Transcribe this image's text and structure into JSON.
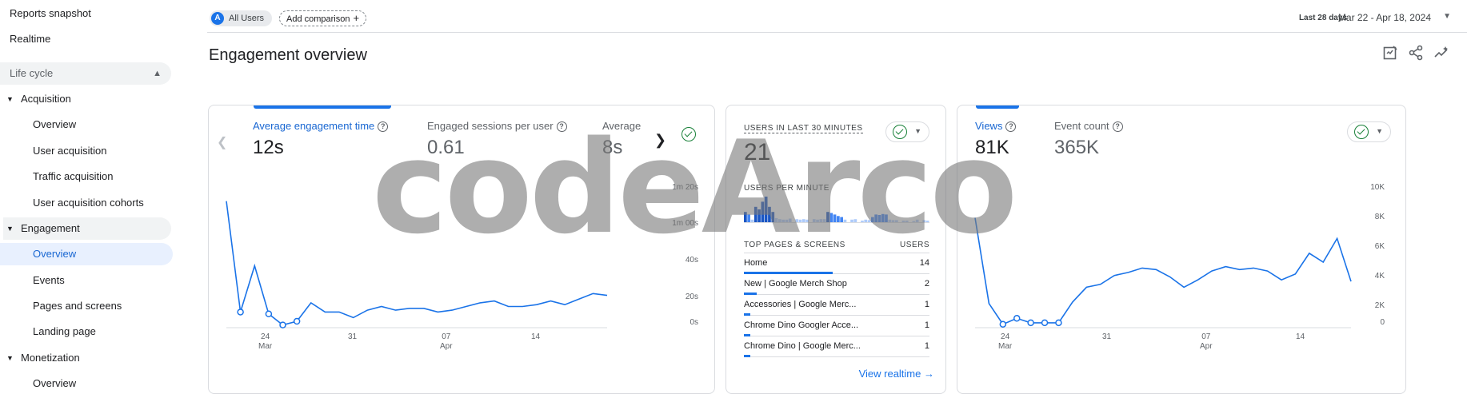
{
  "sidebar": {
    "reports_snapshot": "Reports snapshot",
    "realtime": "Realtime",
    "lifecycle": "Life cycle",
    "acquisition": "Acquisition",
    "acq_items": [
      "Overview",
      "User acquisition",
      "Traffic acquisition",
      "User acquisition cohorts"
    ],
    "engagement": "Engagement",
    "eng_items": [
      "Overview",
      "Events",
      "Pages and screens",
      "Landing page"
    ],
    "monetization": "Monetization",
    "mon_items": [
      "Overview"
    ]
  },
  "topbar": {
    "segment_initial": "A",
    "segment_label": "All Users",
    "add_comparison": "Add comparison",
    "date_label": "Last 28 days",
    "date_range": "Mar 22 - Apr 18, 2024"
  },
  "page": {
    "title": "Engagement overview"
  },
  "card1": {
    "metrics": [
      {
        "label": "Average engagement time",
        "value": "12s"
      },
      {
        "label": "Engaged sessions per user",
        "value": "0.61"
      },
      {
        "label": "Average e",
        "value": "8s"
      }
    ],
    "y_ticks": [
      "1m 20s",
      "1m 00s",
      "40s",
      "20s",
      "0s"
    ],
    "x_ticks": [
      {
        "day": "24",
        "month": "Mar"
      },
      {
        "day": "31",
        "month": ""
      },
      {
        "day": "07",
        "month": "Apr"
      },
      {
        "day": "14",
        "month": ""
      }
    ]
  },
  "card2": {
    "users_label": "USERS IN LAST 30 MINUTES",
    "users_value": "21",
    "per_minute_label": "USERS PER MINUTE",
    "table_head_left": "TOP PAGES & SCREENS",
    "table_head_right": "USERS",
    "rows": [
      {
        "name": "Home",
        "users": "14",
        "share": 0.48
      },
      {
        "name": "New | Google Merch Shop",
        "users": "2",
        "share": 0.07
      },
      {
        "name": "Accessories | Google Merc...",
        "users": "1",
        "share": 0.035
      },
      {
        "name": "Chrome Dino Googler Acce...",
        "users": "1",
        "share": 0.035
      },
      {
        "name": "Chrome Dino | Google Merc...",
        "users": "1",
        "share": 0.035
      }
    ],
    "view_realtime": "View realtime"
  },
  "card3": {
    "metrics": [
      {
        "label": "Views",
        "value": "81K"
      },
      {
        "label": "Event count",
        "value": "365K"
      }
    ],
    "y_ticks": [
      "10K",
      "8K",
      "6K",
      "4K",
      "2K",
      "0"
    ],
    "x_ticks": [
      {
        "day": "24",
        "month": "Mar"
      },
      {
        "day": "31",
        "month": ""
      },
      {
        "day": "07",
        "month": "Apr"
      },
      {
        "day": "14",
        "month": ""
      }
    ]
  },
  "watermark": "codeArco",
  "chart_data": [
    {
      "type": "line",
      "ylim": [
        0,
        80
      ],
      "x": [
        "Mar 22",
        "Mar 23",
        "Mar 24",
        "Mar 25",
        "Mar 26",
        "Mar 27",
        "Mar 28",
        "Mar 29",
        "Mar 30",
        "Mar 31",
        "Apr 1",
        "Apr 2",
        "Apr 3",
        "Apr 4",
        "Apr 5",
        "Apr 6",
        "Apr 7",
        "Apr 8",
        "Apr 9",
        "Apr 10",
        "Apr 11",
        "Apr 12",
        "Apr 13",
        "Apr 14",
        "Apr 15",
        "Apr 16",
        "Apr 17",
        "Apr 18"
      ],
      "series": [
        {
          "values": [
            65,
            5,
            30,
            4,
            -2,
            0,
            10,
            5,
            5,
            2,
            6,
            8,
            6,
            7,
            7,
            5,
            6,
            8,
            10,
            11,
            8,
            8,
            9,
            11,
            9,
            12,
            15,
            14
          ]
        }
      ]
    },
    {
      "type": "line",
      "ylim": [
        0,
        10000
      ],
      "x": [
        "Mar 22",
        "Mar 23",
        "Mar 24",
        "Mar 25",
        "Mar 26",
        "Mar 27",
        "Mar 28",
        "Mar 29",
        "Mar 30",
        "Mar 31",
        "Apr 1",
        "Apr 2",
        "Apr 3",
        "Apr 4",
        "Apr 5",
        "Apr 6",
        "Apr 7",
        "Apr 8",
        "Apr 9",
        "Apr 10",
        "Apr 11",
        "Apr 12",
        "Apr 13",
        "Apr 14",
        "Apr 15",
        "Apr 16",
        "Apr 17",
        "Apr 18"
      ],
      "series": [
        {
          "values": [
            7000,
            1200,
            -200,
            200,
            -100,
            -100,
            -100,
            1300,
            2300,
            2500,
            3100,
            3300,
            3600,
            3500,
            3000,
            2300,
            2800,
            3400,
            3700,
            3500,
            3600,
            3400,
            2800,
            3200,
            4600,
            4000,
            5600,
            2700
          ]
        }
      ]
    },
    {
      "type": "bar",
      "title": "USERS PER MINUTE",
      "values": [
        2,
        1.5,
        0.5,
        3,
        2.5,
        4,
        5,
        3,
        2,
        0.8,
        0.6,
        0.5,
        0.5,
        0.7,
        0,
        0.6,
        0.5,
        0.6,
        0.5,
        0,
        0.6,
        0.5,
        0.6,
        0.6,
        2,
        1.8,
        1.5,
        1.2,
        1,
        0.5,
        0,
        0.5,
        0.6,
        0,
        0.3,
        0.5,
        0.4,
        1,
        1.5,
        1.4,
        1.6,
        1.5,
        0.5,
        0.4,
        0.4,
        0,
        0.3,
        0.3,
        0,
        0.2,
        0.5,
        0,
        0.4,
        0.3
      ]
    }
  ]
}
